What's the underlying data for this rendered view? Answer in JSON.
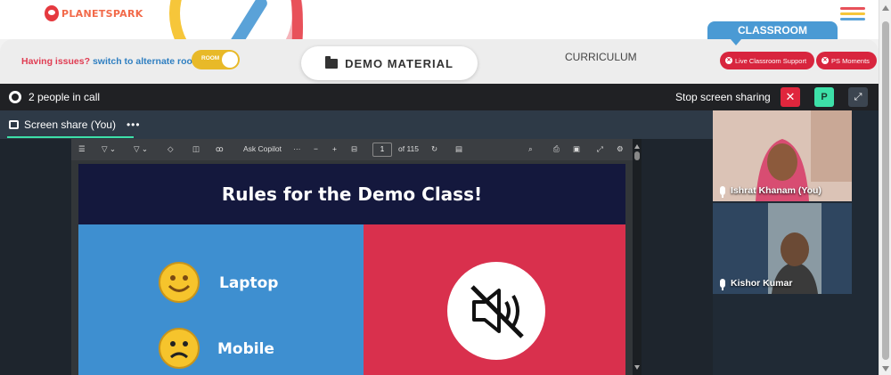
{
  "header": {
    "logo_text": "PLANETSPARK",
    "colors": {
      "brand_orange": "#f26a4a",
      "brand_blue": "#3d3aa3"
    }
  },
  "toolbar": {
    "issues_text": "Having issues?",
    "switch_link": "switch to alternate room",
    "room_toggle_label": "ROOM",
    "demo_material_label": "DEMO MATERIAL",
    "curriculum_label": "CURRICULUM",
    "classroom_label": "CLASSROOM",
    "live_support_label": "Live Classroom Support",
    "ps_moments_label": "PS Moments"
  },
  "call": {
    "people_text": "2 people in call",
    "stop_sharing_label": "Stop screen sharing",
    "close_symbol": "✕",
    "presenter_initial": "P",
    "share_tab_label": "Screen share (You)",
    "more_symbol": "•••"
  },
  "pdf_viewer": {
    "ask_copilot_label": "Ask Copilot",
    "page_current": "1",
    "page_total": "of 115",
    "minus": "−",
    "plus": "+",
    "more": "···"
  },
  "slide": {
    "title": "Rules for the Demo Class!",
    "item1": "Laptop",
    "item2": "Mobile"
  },
  "participants": [
    {
      "name": "Ishrat Khanam (You)"
    },
    {
      "name": "Kishor Kumar"
    }
  ]
}
